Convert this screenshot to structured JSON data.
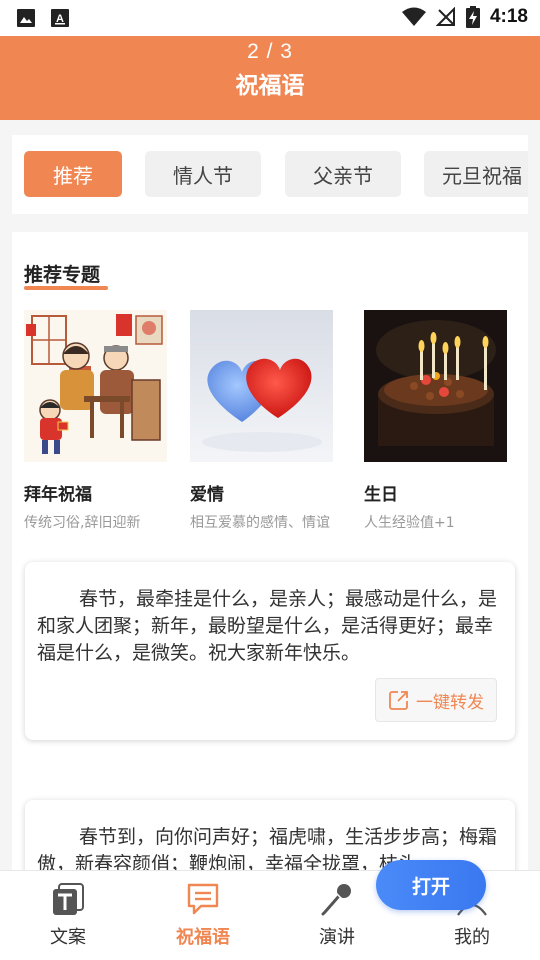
{
  "status_bar": {
    "time": "4:18"
  },
  "header": {
    "pager": "2 / 3",
    "title": "祝福语"
  },
  "tabs": [
    {
      "label": "推荐",
      "active": true
    },
    {
      "label": "情人节",
      "active": false
    },
    {
      "label": "父亲节",
      "active": false
    },
    {
      "label": "元旦祝福",
      "active": false
    }
  ],
  "section": {
    "title": "推荐专题"
  },
  "topics": [
    {
      "name": "拜年祝福",
      "desc": "传统习俗,辞旧迎新"
    },
    {
      "name": "爱情",
      "desc": "相互爱慕的感情、情谊"
    },
    {
      "name": "生日",
      "desc": "人生经验值+1"
    }
  ],
  "cards": [
    {
      "text": "春节，最牵挂是什么，是亲人；最感动是什么，是和家人团聚；新年，最盼望是什么，是活得更好；最幸福是什么，是微笑。祝大家新年快乐。",
      "share_label": "一键转发"
    },
    {
      "text": "春节到，向你问声好；福虎啸，生活步步高；梅霜傲，新春容颜俏；鞭炮闹，幸福全拢罩，枝头"
    }
  ],
  "float_button": {
    "label": "打开"
  },
  "bottom_nav": [
    {
      "label": "文案",
      "active": false
    },
    {
      "label": "祝福语",
      "active": true
    },
    {
      "label": "演讲",
      "active": false
    },
    {
      "label": "我的",
      "active": false
    }
  ],
  "colors": {
    "accent": "#f08753",
    "button_blue": "#3a78f0"
  }
}
